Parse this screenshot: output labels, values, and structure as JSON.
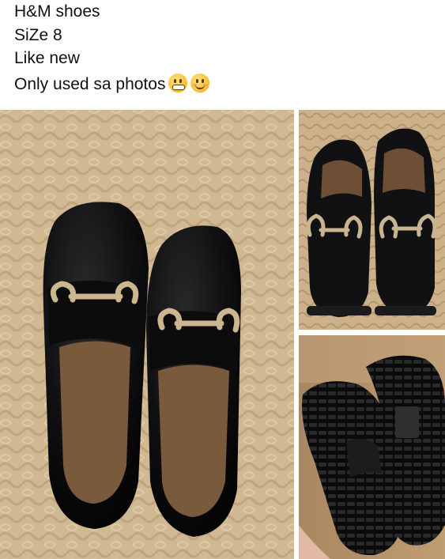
{
  "post": {
    "caption_lines": [
      "H&M shoes",
      "SiZe 8",
      "Like new",
      "Only used sa photos"
    ],
    "emojis": [
      "grimacing-face-emoji",
      "smiling-face-emoji"
    ]
  },
  "colors": {
    "jute_rug": "#c9b08a",
    "leather": "#0f0f10",
    "buckle_gold": "#cbb690",
    "insole": "#7a5a3d",
    "floor_wood": "#b48e63"
  }
}
